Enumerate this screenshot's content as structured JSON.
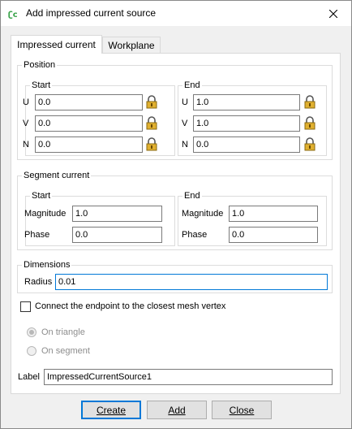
{
  "window": {
    "title": "Add impressed current source",
    "close_glyph": "✕"
  },
  "tabs": [
    {
      "label": "Impressed current"
    },
    {
      "label": "Workplane"
    }
  ],
  "position": {
    "title": "Position",
    "start": {
      "title": "Start",
      "u_label": "U",
      "u": "0.0",
      "v_label": "V",
      "v": "0.0",
      "n_label": "N",
      "n": "0.0"
    },
    "end": {
      "title": "End",
      "u_label": "U",
      "u": "1.0",
      "v_label": "V",
      "v": "1.0",
      "n_label": "N",
      "n": "0.0"
    }
  },
  "segment": {
    "title": "Segment current",
    "start": {
      "title": "Start",
      "mag_label": "Magnitude",
      "mag": "1.0",
      "phase_label": "Phase",
      "phase": "0.0"
    },
    "end": {
      "title": "End",
      "mag_label": "Magnitude",
      "mag": "1.0",
      "phase_label": "Phase",
      "phase": "0.0"
    }
  },
  "dimensions": {
    "title": "Dimensions",
    "radius_label": "Radius",
    "radius": "0.01"
  },
  "connect": {
    "label": "Connect the endpoint to the closest mesh vertex",
    "checked": false
  },
  "radios": {
    "triangle": "On triangle",
    "segment": "On segment"
  },
  "label_field": {
    "label": "Label",
    "value": "ImpressedCurrentSource1"
  },
  "buttons": {
    "create": "Create",
    "add": "Add",
    "close": "Close"
  },
  "colors": {
    "accent": "#0078d7",
    "icon_green": "#3aa34a",
    "lock_gold": "#e0b030"
  },
  "icons": {
    "app": "app-logo-icon",
    "lock": "lock-icon",
    "close": "close-icon"
  }
}
